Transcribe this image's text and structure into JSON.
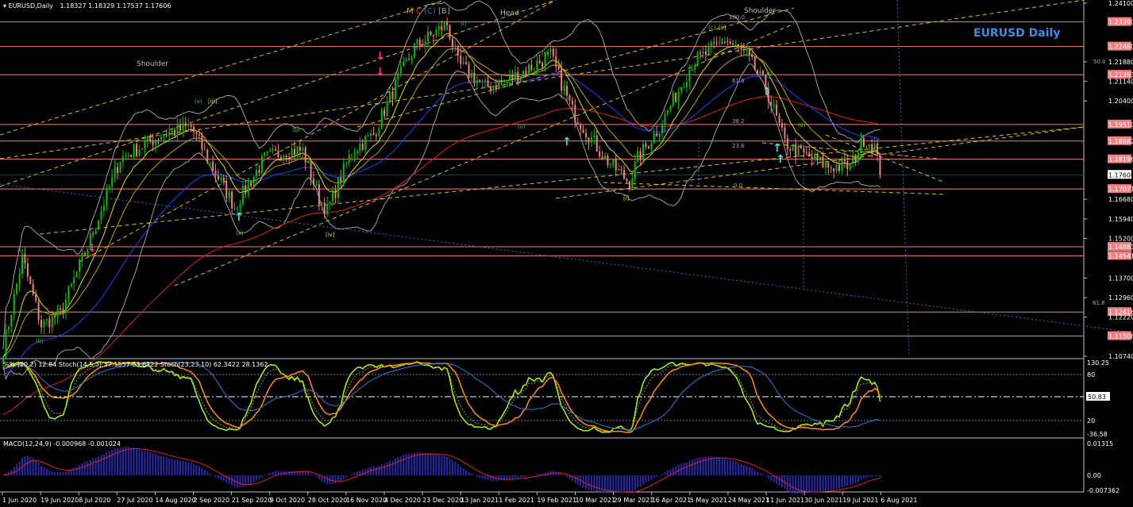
{
  "header": {
    "symbol": "EURUSD,Daily",
    "ohlc": "1.18327 1.18329 1.17537 1.17606"
  },
  "title_overlay": "EURUSD Daily",
  "annotations": {
    "shoulder_left": "Shoulder",
    "head": "Head",
    "shoulder_right": "Shoulder",
    "wave_labels": [
      {
        "text": "M",
        "color": "#e0a000"
      },
      {
        "text": "C",
        "color": "#e03030"
      },
      {
        "text": "(C)",
        "color": "#3a70c0"
      },
      {
        "text": "[B]",
        "color": "#a0a0a0"
      }
    ],
    "waves": [
      "(i)",
      "(ii)",
      "(v)",
      "[iii]",
      "(a)",
      "(b)",
      "[iv]",
      "(i)",
      "(ii)",
      "(v)",
      "[i]",
      "(c)",
      "[ii]",
      "(i)",
      "(ii)"
    ],
    "fib": [
      "100.0",
      "50.0",
      "61.8",
      "38.2",
      "23.6",
      "0.0",
      "50.0",
      "61.8"
    ]
  },
  "price_axis": {
    "ticks": [
      "1.24100",
      "1.21880",
      "1.21140",
      "1.20400",
      "1.16680",
      "1.15940",
      "1.15200",
      "1.13700",
      "1.12960",
      "1.12220",
      "1.10740"
    ],
    "levels": [
      "1.23390",
      "1.22460",
      "1.21393",
      "1.19510",
      "1.18882",
      "1.18196",
      "1.17071",
      "1.14883",
      "1.14541",
      "1.12416",
      "1.11506"
    ],
    "current": "1.17606",
    "level_color": "#f08080"
  },
  "dates": [
    "1 Jun 2020",
    "19 Jun 2020",
    "8 Jul 2020",
    "27 Jul 2020",
    "14 Aug 2020",
    "2 Sep 2020",
    "21 Sep 2020",
    "9 Oct 2020",
    "28 Oct 2020",
    "16 Nov 2020",
    "4 Dec 2020",
    "23 Dec 2020",
    "13 Jan 2021",
    "1 Feb 2021",
    "19 Feb 2021",
    "10 Mar 2021",
    "29 Mar 2021",
    "16 Apr 2021",
    "5 May 2021",
    "24 May 2021",
    "11 Jun 2021",
    "30 Jun 2021",
    "19 Jul 2021",
    "6 Aug 2021"
  ],
  "stoch": {
    "label": "%% (20,2) 12.84  Stoch(14,5,3) 37.1557 63.6322  Stoch(23,23,10) 62.3422 28.1362",
    "axis": [
      "130.25",
      "80",
      "50.83",
      "20",
      "-36.58"
    ]
  },
  "macd": {
    "label": "MACD(12,24,9) -0.000968 -0.001024",
    "axis": [
      "0.01315",
      "0.00",
      "-0.007362"
    ]
  },
  "colors": {
    "bull": "#00c000",
    "bear": "#f08080",
    "ma_long": "#e02020",
    "ma_mid": "#2040ff",
    "ma_fast": "#e0e000",
    "bands": "#a0a0a0"
  },
  "price_path": [
    [
      0,
      1.1101
    ],
    [
      7,
      1.1446
    ],
    [
      14,
      1.1191
    ],
    [
      21,
      1.1236
    ],
    [
      31,
      1.1491
    ],
    [
      43,
      1.1822
    ],
    [
      58,
      1.1912
    ],
    [
      69,
      1.1942
    ],
    [
      75,
      1.1822
    ],
    [
      85,
      1.1641
    ],
    [
      96,
      1.1822
    ],
    [
      104,
      1.1852
    ],
    [
      110,
      1.1852
    ],
    [
      116,
      1.1671
    ],
    [
      119,
      1.1626
    ],
    [
      128,
      1.1852
    ],
    [
      136,
      1.1912
    ],
    [
      145,
      1.2122
    ],
    [
      151,
      1.2242
    ],
    [
      163,
      1.2332
    ],
    [
      167,
      1.2182
    ],
    [
      177,
      1.2092
    ],
    [
      186,
      1.2122
    ],
    [
      201,
      1.2212
    ],
    [
      209,
      1.2002
    ],
    [
      221,
      1.1822
    ],
    [
      230,
      1.1732
    ],
    [
      233,
      1.1822
    ],
    [
      241,
      1.1942
    ],
    [
      253,
      1.2182
    ],
    [
      265,
      1.2272
    ],
    [
      273,
      1.2212
    ],
    [
      280,
      1.2092
    ],
    [
      287,
      1.1882
    ],
    [
      291,
      1.1852
    ],
    [
      303,
      1.1792
    ],
    [
      311,
      1.1792
    ],
    [
      316,
      1.1897
    ],
    [
      320,
      1.1867
    ],
    [
      322,
      1.1761
    ]
  ]
}
